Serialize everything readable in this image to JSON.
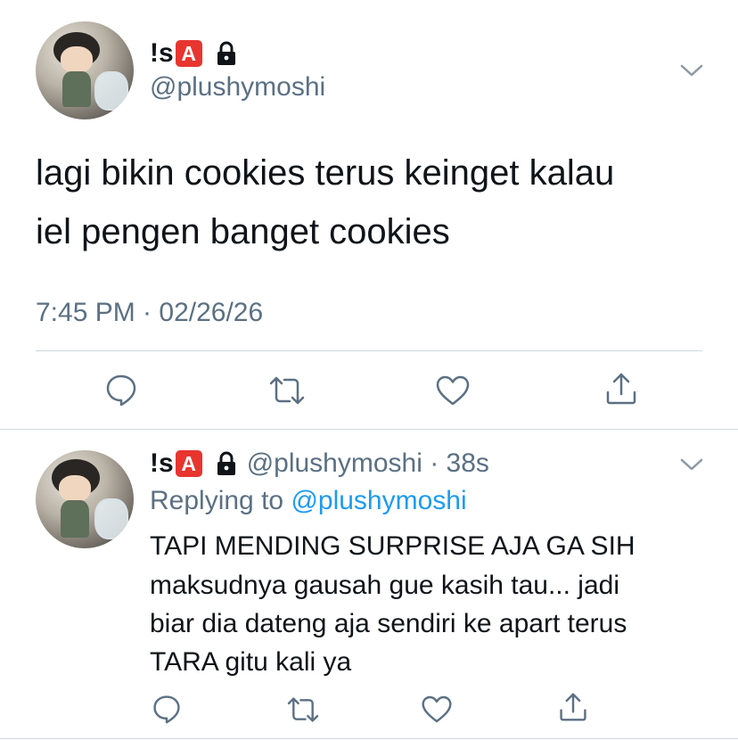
{
  "tweet": {
    "display_name": "!s",
    "badge_letter": "A",
    "handle": "@plushymoshi",
    "text_line1": "lagi bikin cookies terus keinget kalau",
    "text_line2": "iel pengen banget cookies",
    "timestamp": "7:45 PM · 02/26/26"
  },
  "reply": {
    "display_name": "!s",
    "badge_letter": "A",
    "handle_time": "@plushymoshi · 38s",
    "replying_prefix": "Replying to",
    "replying_handle": "@plushymoshi",
    "text_line1": "TAPI MENDING SURPRISE AJA GA SIH",
    "text_line2": "maksudnya gausah gue kasih tau... jadi",
    "text_line3": "biar dia dateng aja sendiri ke apart terus",
    "text_line4": "TARA gitu kali ya"
  },
  "icons": [
    "lock-icon",
    "chevron-down-icon",
    "reply-icon",
    "retweet-icon",
    "like-icon",
    "share-icon"
  ],
  "colors": {
    "badge": "#e8352f",
    "link": "#1d9bf0",
    "muted": "#5b7083",
    "icon": "#5b7083"
  }
}
